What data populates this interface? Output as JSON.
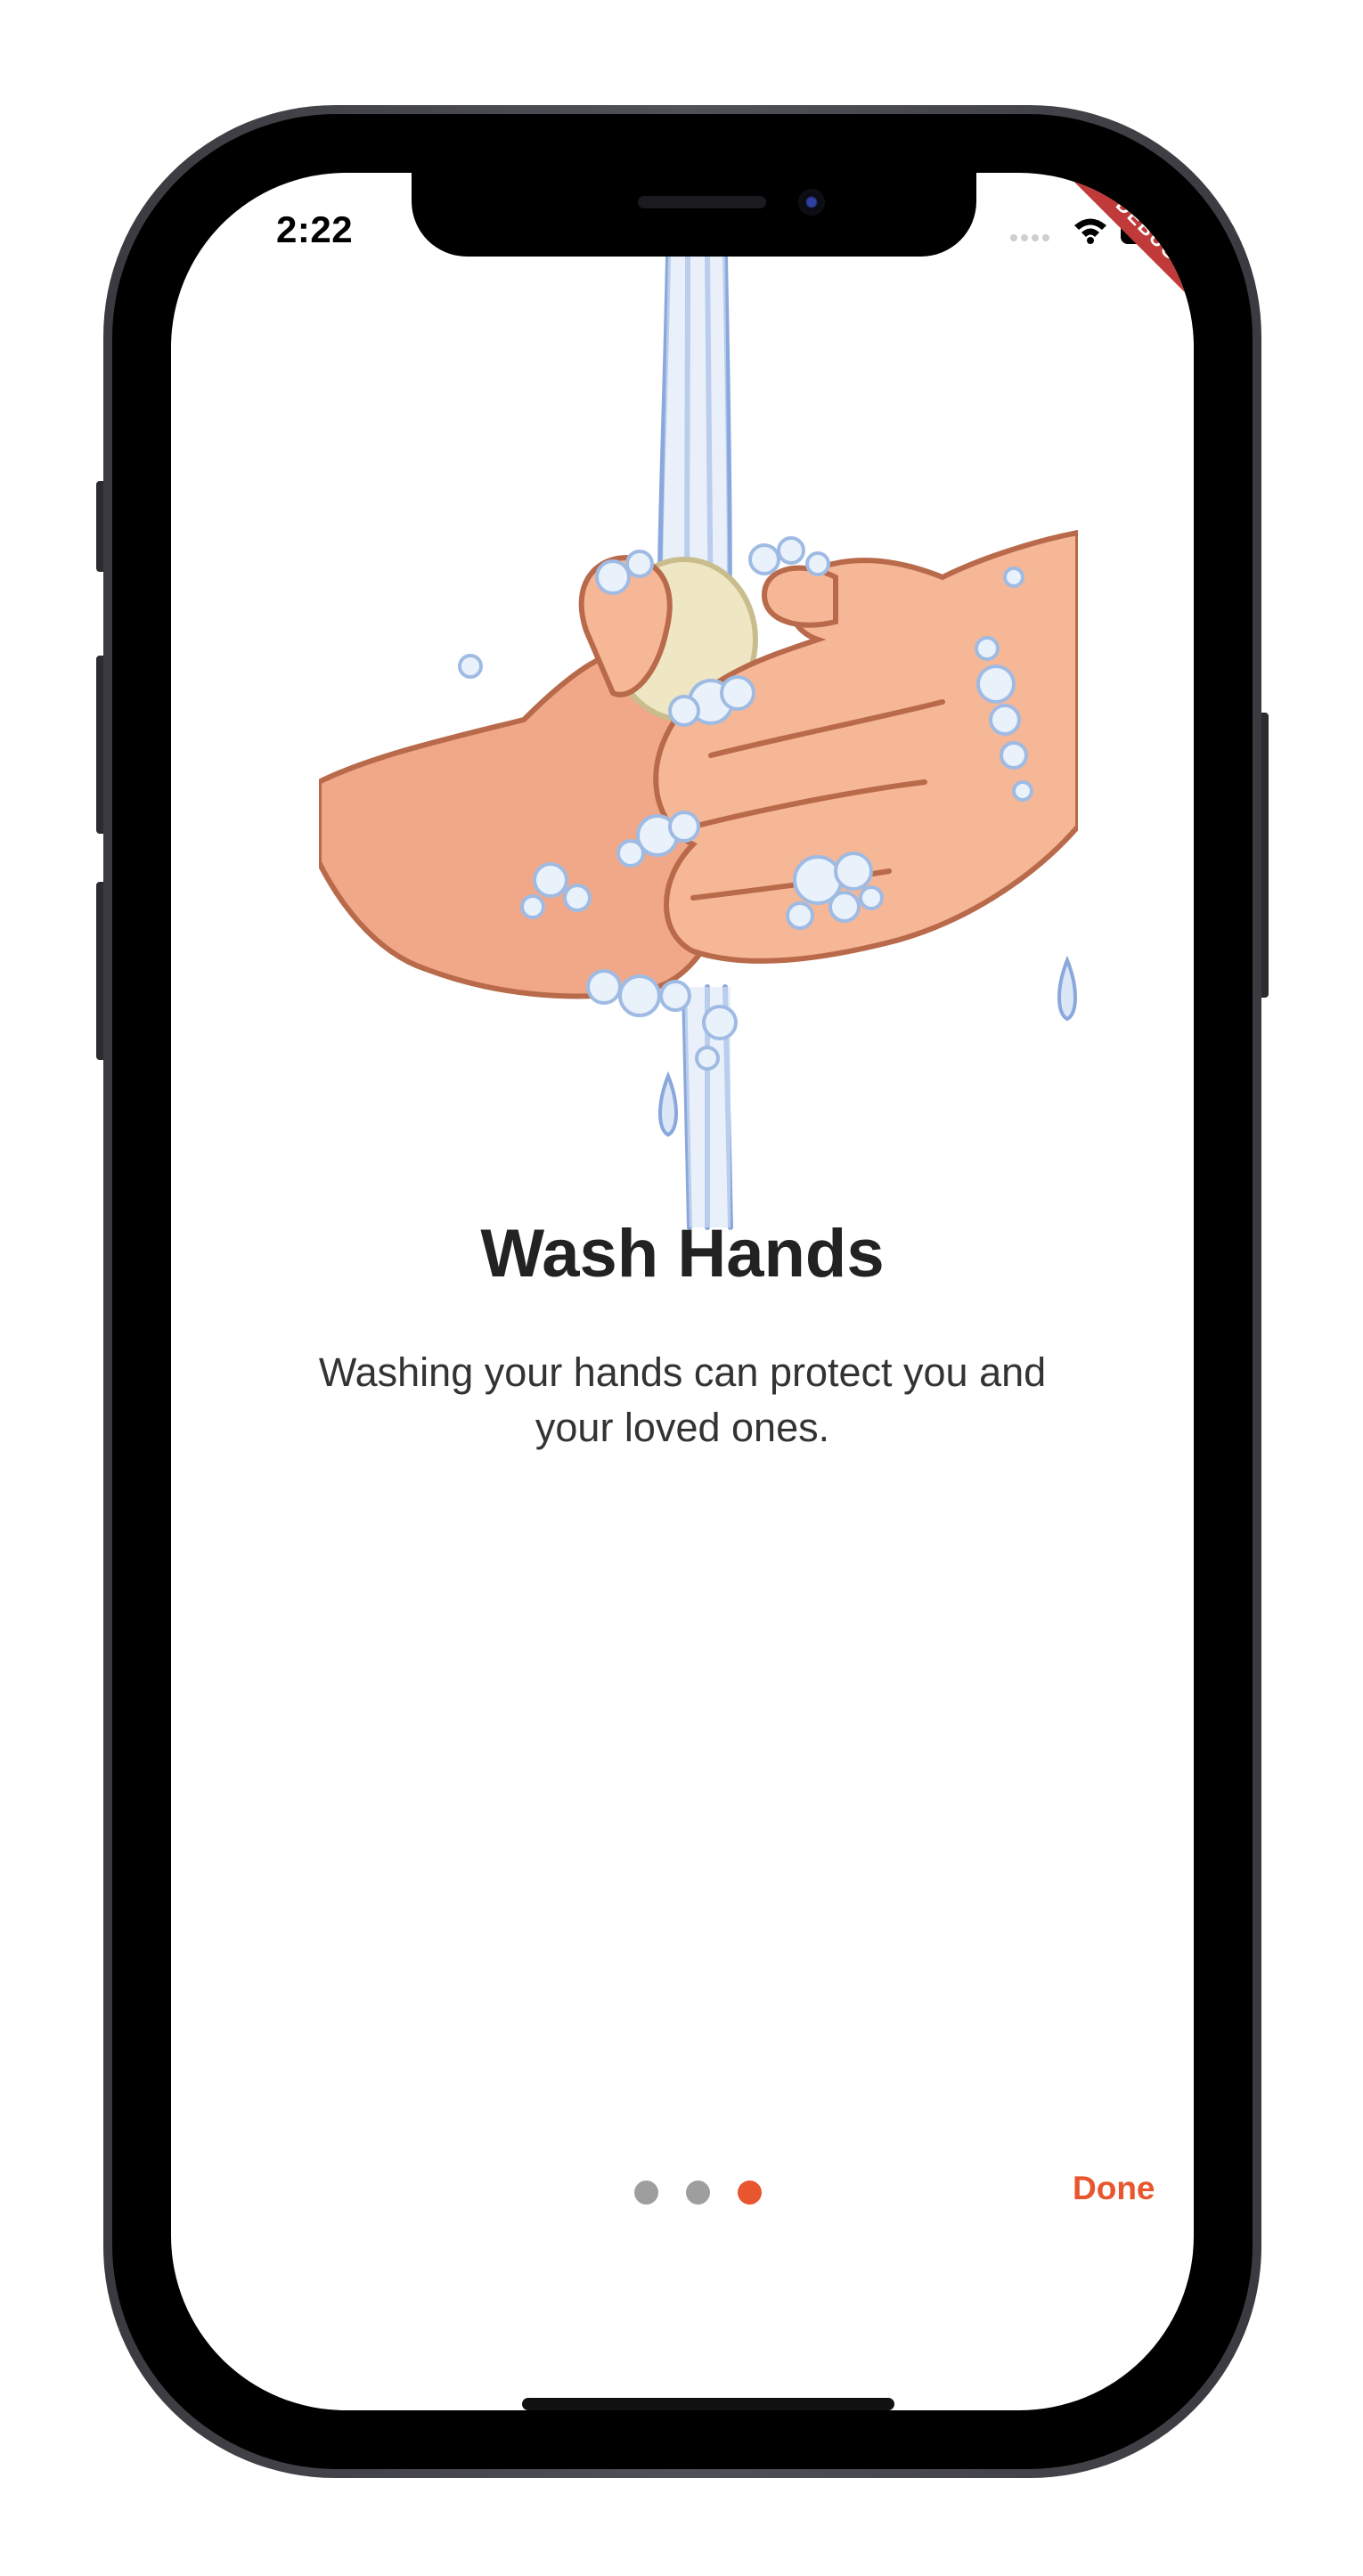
{
  "status_bar": {
    "time": "2:22",
    "debug_banner": "DEBUG"
  },
  "onboarding": {
    "title": "Wash Hands",
    "description": "Washing your hands can protect you and your loved ones.",
    "illustration_icon": "hands-washing-with-soap-illustration",
    "page_count": 3,
    "current_page": 3,
    "done_label": "Done"
  },
  "colors": {
    "accent": "#e8552e",
    "dot_inactive": "#9e9e9e",
    "text_primary": "#222222",
    "debug_banner": "#c13a3a"
  }
}
